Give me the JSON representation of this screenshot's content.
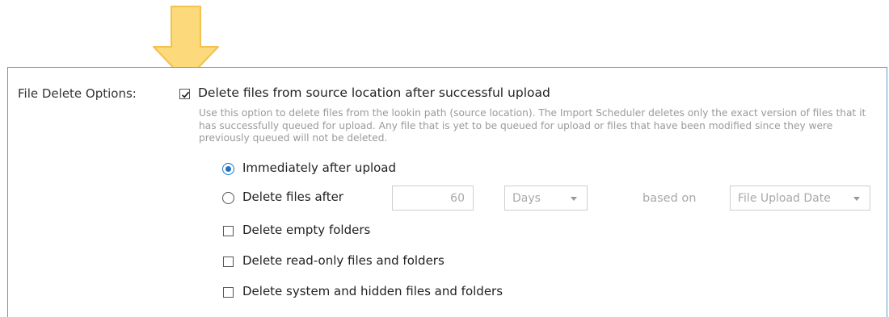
{
  "colors": {
    "accent": "#1a73c7",
    "panel_border": "#5b9bd5",
    "arrow_fill": "#fcd97a",
    "arrow_stroke": "#f2c14e"
  },
  "icons": {
    "highlight_arrow": "down-arrow-icon",
    "check": "checkmark-icon",
    "dropdown": "chevron-down-icon"
  },
  "file_delete": {
    "label": "File Delete Options:",
    "main_option": {
      "label": "Delete files from source location after successful upload",
      "checked": true
    },
    "description": "Use this option to delete files from the lookin path (source location). The Import Scheduler deletes only the exact version of files that it has successfully queued for upload. Any file that is yet to be queued for upload or files that have been modified since they were previously queued will not be deleted.",
    "timing": {
      "immediately": {
        "label": "Immediately after upload",
        "selected": true
      },
      "after": {
        "label": "Delete files after",
        "selected": false,
        "amount": "60",
        "unit": "Days",
        "based_on_label": "based on",
        "based_on_value": "File Upload Date"
      }
    },
    "options": [
      {
        "label": "Delete empty folders",
        "checked": false
      },
      {
        "label": "Delete read-only files and folders",
        "checked": false
      },
      {
        "label": "Delete system and hidden files and folders",
        "checked": false
      }
    ]
  }
}
